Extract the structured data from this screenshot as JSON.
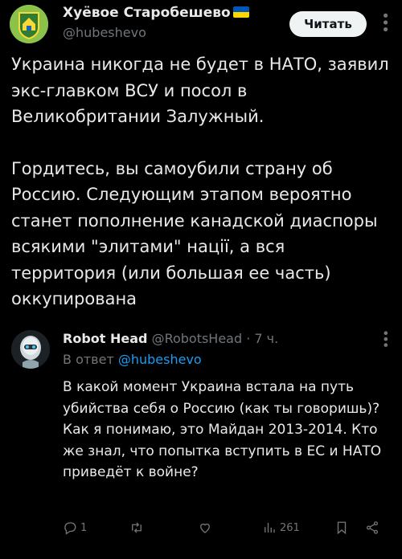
{
  "tweet": {
    "author_name": "Хуёвое Старобешево",
    "author_handle": "@hubeshevo",
    "read_button": "Читать",
    "paragraphs": [
      "Украина никогда не будет в НАТО, заявил экс-главком ВСУ и посол в Великобритании Залужный.",
      "Гордитесь, вы самоубили страну об Россию. Следующим этапом вероятно станет пополнение канадской диаспоры всякими \"элитами\" нації, а вся территория (или большая ее часть) оккупирована"
    ],
    "flag_colors": [
      "#0057b7",
      "#ffd700"
    ]
  },
  "reply": {
    "author_name": "Robot Head",
    "author_handle": "@RobotsHead",
    "time": "· 7 ч.",
    "reply_to_prefix": "В ответ",
    "reply_to_handle": "@hubeshevo",
    "lines": [
      "В какой момент Украина встала на путь убийства себя о Россию (как ты говоришь)?",
      "Как я понимаю, это Майдан 2013-2014. Кто же знал, что попытка вступить в ЕС и НАТО приведёт к войне?"
    ],
    "actions": {
      "reply_count": "1",
      "retweet_count": "",
      "like_count": "",
      "views_count": "261"
    }
  },
  "icons": [
    "more-icon",
    "reply-icon",
    "retweet-icon",
    "like-icon",
    "views-icon",
    "bookmark-icon",
    "share-icon"
  ],
  "colors": {
    "accent": "#1d9bf0",
    "muted": "#71767b",
    "text": "#e7e9ea",
    "background": "#000000"
  }
}
